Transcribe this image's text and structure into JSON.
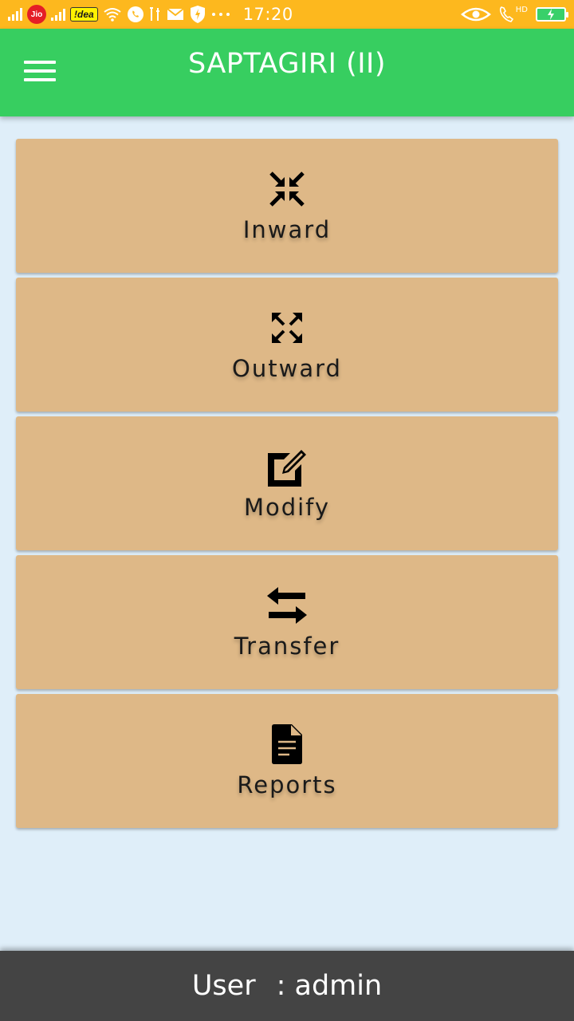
{
  "status_bar": {
    "time": "17:20",
    "carrier1": "Jio",
    "carrier2": "!dea",
    "network_label": "HD",
    "background": "#FDB81E"
  },
  "app_bar": {
    "title": "SAPTAGIRI (II)",
    "menu_icon": "hamburger-menu-icon",
    "background": "#37CE60"
  },
  "menu": {
    "card_color": "#DEB887",
    "items": [
      {
        "label": "Inward",
        "icon": "arrows-inward-icon"
      },
      {
        "label": "Outward",
        "icon": "arrows-outward-icon"
      },
      {
        "label": "Modify",
        "icon": "edit-icon"
      },
      {
        "label": "Transfer",
        "icon": "swap-arrows-icon"
      },
      {
        "label": "Reports",
        "icon": "document-icon"
      }
    ]
  },
  "footer": {
    "user_label": "User",
    "user_value": ": admin",
    "background": "#444444"
  }
}
